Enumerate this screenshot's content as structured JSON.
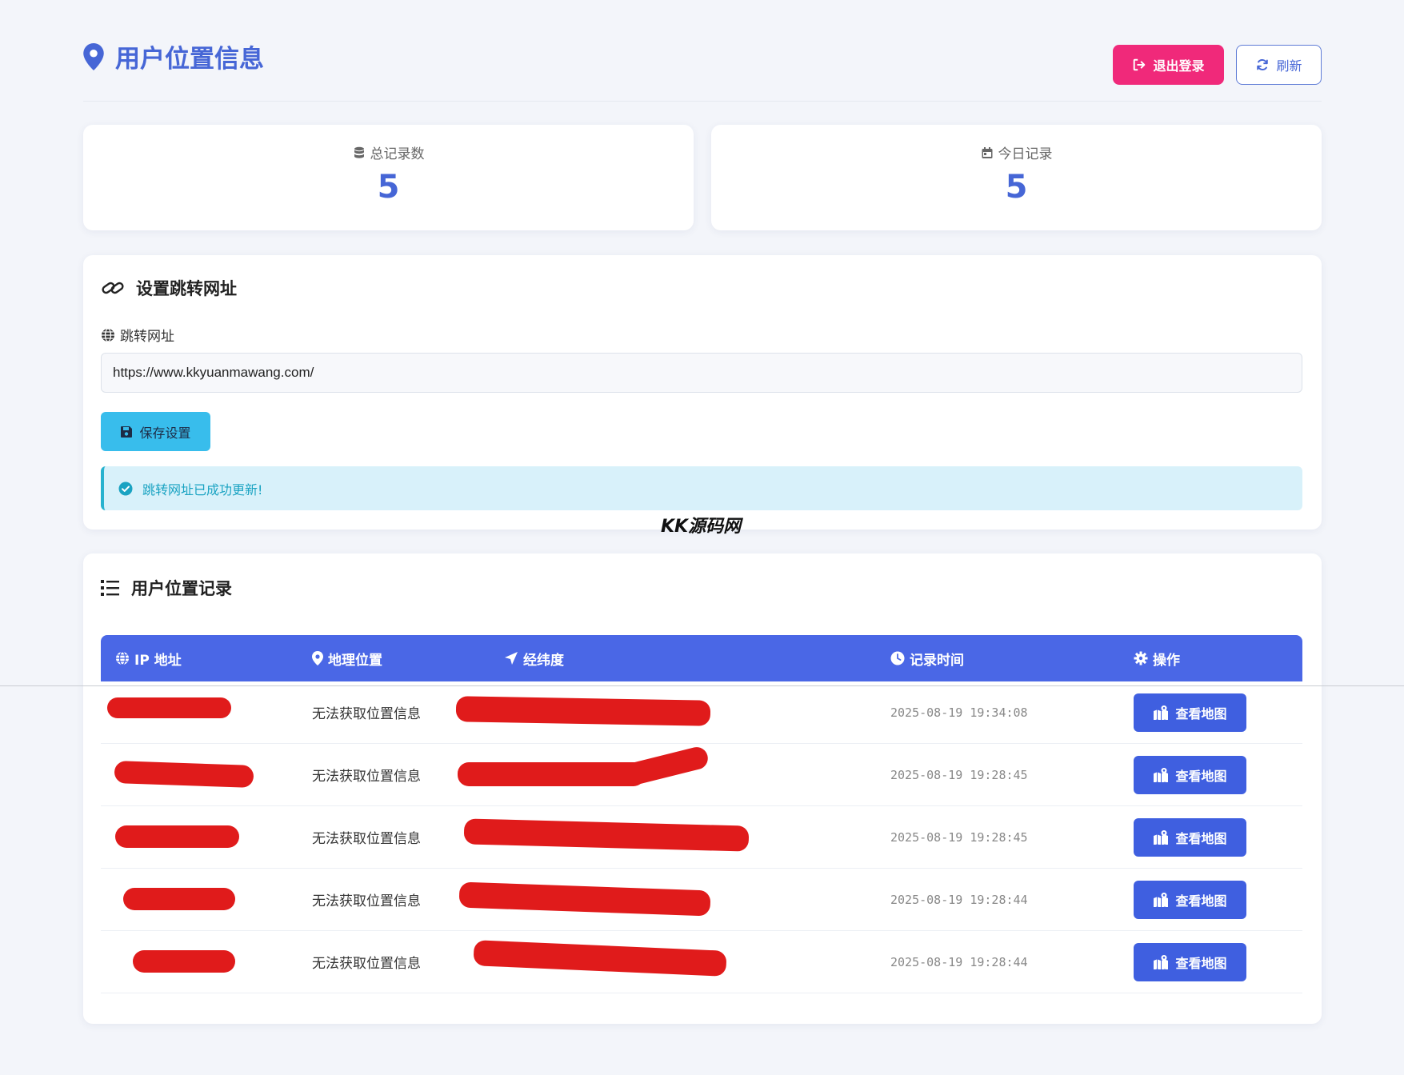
{
  "header": {
    "title": "用户位置信息",
    "logout_label": "退出登录",
    "refresh_label": "刷新"
  },
  "stats": {
    "total_label": "总记录数",
    "total_value": "5",
    "today_label": "今日记录",
    "today_value": "5"
  },
  "settings": {
    "title": "设置跳转网址",
    "field_label": "跳转网址",
    "url_value": "https://www.kkyuanmawang.com/",
    "save_label": "保存设置",
    "alert_text": "跳转网址已成功更新!"
  },
  "watermark": "KK源码网",
  "records": {
    "title": "用户位置记录",
    "columns": {
      "ip": "IP 地址",
      "location": "地理位置",
      "coords": "经纬度",
      "time": "记录时间",
      "action": "操作"
    },
    "rows": [
      {
        "ip": "",
        "location": "无法获取位置信息",
        "coords": "",
        "time": "2025-08-19 19:34:08",
        "action": "查看地图"
      },
      {
        "ip": "",
        "location": "无法获取位置信息",
        "coords": "",
        "time": "2025-08-19 19:28:45",
        "action": "查看地图"
      },
      {
        "ip": "",
        "location": "无法获取位置信息",
        "coords": "",
        "time": "2025-08-19 19:28:45",
        "action": "查看地图"
      },
      {
        "ip": "",
        "location": "无法获取位置信息",
        "coords": "",
        "time": "2025-08-19 19:28:44",
        "action": "查看地图"
      },
      {
        "ip": "",
        "location": "无法获取位置信息",
        "coords": "",
        "time": "2025-08-19 19:28:44",
        "action": "查看地图"
      }
    ]
  },
  "colors": {
    "primary": "#4a67e6",
    "logout": "#f0297a",
    "save": "#38bdec",
    "redaction": "#e01b1b"
  }
}
